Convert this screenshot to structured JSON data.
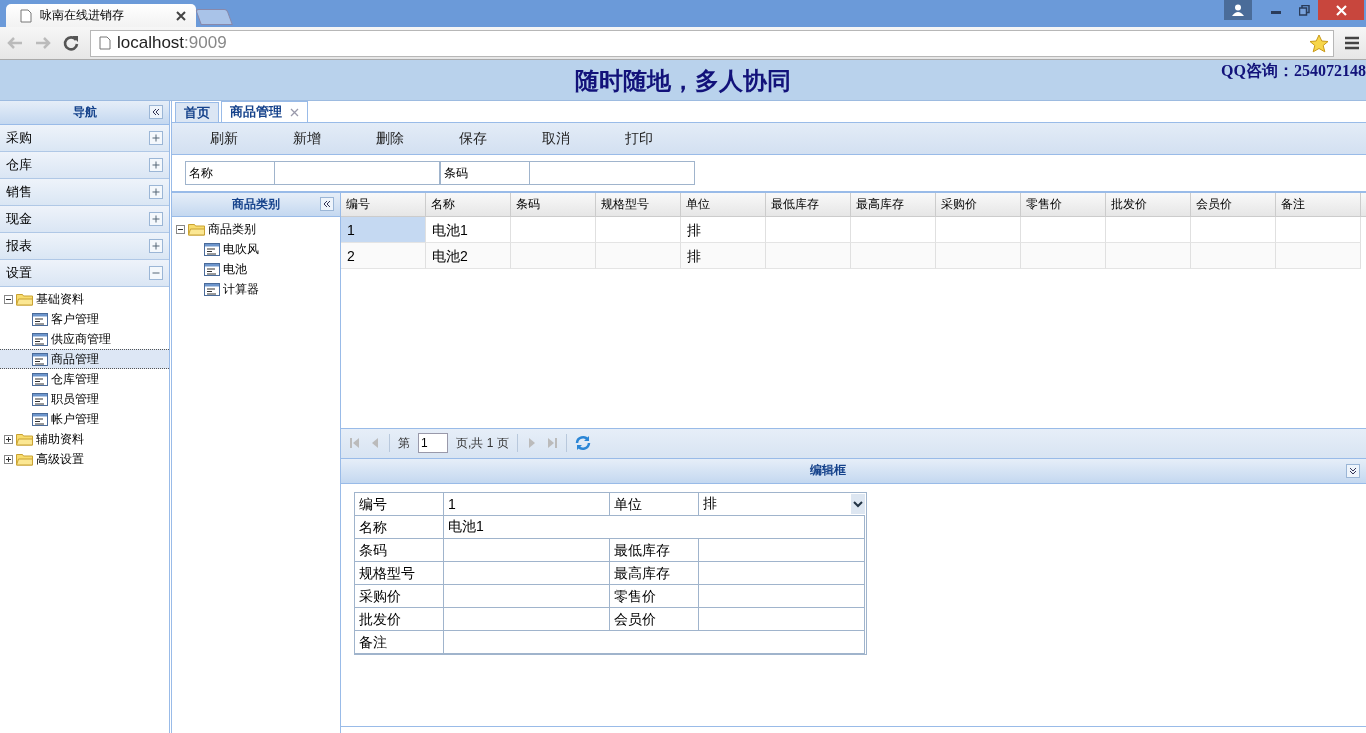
{
  "browser": {
    "tab_title": "咏南在线进销存",
    "url_host": "localhost",
    "url_port": ":9009"
  },
  "header": {
    "title": "随时随地，多人协同",
    "contact": "QQ咨询：254072148"
  },
  "nav": {
    "title": "导航",
    "sections": [
      {
        "label": "采购",
        "expanded": false
      },
      {
        "label": "仓库",
        "expanded": false
      },
      {
        "label": "销售",
        "expanded": false
      },
      {
        "label": "现金",
        "expanded": false
      },
      {
        "label": "报表",
        "expanded": false
      },
      {
        "label": "设置",
        "expanded": true,
        "tree": [
          {
            "label": "基础资料",
            "expanded": true,
            "children": [
              {
                "label": "客户管理",
                "selected": false
              },
              {
                "label": "供应商管理",
                "selected": false
              },
              {
                "label": "商品管理",
                "selected": true
              },
              {
                "label": "仓库管理",
                "selected": false
              },
              {
                "label": "职员管理",
                "selected": false
              },
              {
                "label": "帐户管理",
                "selected": false
              }
            ]
          },
          {
            "label": "辅助资料",
            "expanded": false
          },
          {
            "label": "高级设置",
            "expanded": false
          }
        ]
      }
    ]
  },
  "tabs": [
    {
      "label": "首页",
      "selected": false,
      "closable": false
    },
    {
      "label": "商品管理",
      "selected": true,
      "closable": true
    }
  ],
  "toolbar": [
    "刷新",
    "新增",
    "删除",
    "保存",
    "取消",
    "打印"
  ],
  "search": [
    {
      "label": "名称"
    },
    {
      "label": "条码"
    }
  ],
  "category": {
    "title": "商品类别",
    "root": {
      "label": "商品类别",
      "expanded": true,
      "children": [
        {
          "label": "电吹风"
        },
        {
          "label": "电池"
        },
        {
          "label": "计算器"
        }
      ]
    }
  },
  "grid": {
    "columns": [
      "编号",
      "名称",
      "条码",
      "规格型号",
      "单位",
      "最低库存",
      "最高库存",
      "采购价",
      "零售价",
      "批发价",
      "会员价",
      "备注"
    ],
    "rows": [
      {
        "cells": {
          "0": "1",
          "1": "电池1",
          "4": "排"
        },
        "selected": true
      },
      {
        "cells": {
          "0": "2",
          "1": "电池2",
          "4": "排"
        },
        "selected": false
      }
    ]
  },
  "pager": {
    "prefix": "第",
    "page": "1",
    "suffix": "页,共 1 页"
  },
  "editor": {
    "title": "编辑框",
    "rows": [
      [
        {
          "label": "编号",
          "value": "1",
          "kind": "text"
        },
        {
          "label": "单位",
          "value": "排",
          "kind": "select"
        }
      ],
      [
        {
          "label": "名称",
          "value": "电池1",
          "kind": "text"
        }
      ],
      [
        {
          "label": "条码",
          "kind": "text"
        },
        {
          "label": "最低库存",
          "kind": "text"
        }
      ],
      [
        {
          "label": "规格型号",
          "kind": "text"
        },
        {
          "label": "最高库存",
          "kind": "text"
        }
      ],
      [
        {
          "label": "采购价",
          "kind": "text"
        },
        {
          "label": "零售价",
          "kind": "text"
        }
      ],
      [
        {
          "label": "批发价",
          "kind": "text"
        },
        {
          "label": "会员价",
          "kind": "text"
        }
      ],
      [
        {
          "label": "备注",
          "kind": "text"
        }
      ]
    ]
  }
}
